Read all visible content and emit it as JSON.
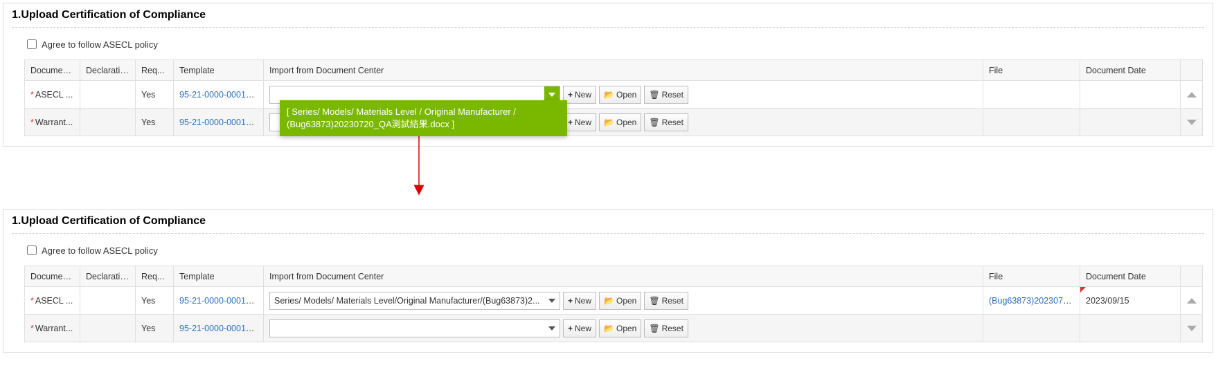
{
  "section_title": "1.Upload Certification of Compliance",
  "agree_label": "Agree to follow ASECL policy",
  "columns": {
    "doc": "Document...",
    "decl": "Declaratio...",
    "req": "Req...",
    "template": "Template",
    "import": "Import from Document Center",
    "file": "File",
    "date": "Document Date"
  },
  "btns": {
    "new": "New",
    "open": "Open",
    "reset": "Reset"
  },
  "dropdown_option": "[ Series/ Models/ Materials Level / Original Manufacturer / (Bug63873)20230720_QA測試結果.docx ]",
  "top": {
    "rows": [
      {
        "doc": "ASECL ...",
        "decl": "",
        "req": "Yes",
        "template": "95-21-0000-0001_1...",
        "combo_value": "",
        "file": "",
        "date": "",
        "caret": "up"
      },
      {
        "doc": "Warrant...",
        "decl": "",
        "req": "Yes",
        "template": "95-21-0000-0001_1...",
        "combo_value": "",
        "file": "",
        "date": "",
        "caret": "down"
      }
    ]
  },
  "bottom": {
    "rows": [
      {
        "doc": "ASECL ...",
        "decl": "",
        "req": "Yes",
        "template": "95-21-0000-0001_1...",
        "combo_value": "Series/ Models/ Materials Level/Original Manufacturer/(Bug63873)2...",
        "file": "(Bug63873)2023072...",
        "date": "2023/09/15",
        "caret": "up"
      },
      {
        "doc": "Warrant...",
        "decl": "",
        "req": "Yes",
        "template": "95-21-0000-0001_1...",
        "combo_value": "",
        "file": "",
        "date": "",
        "caret": "down"
      }
    ]
  }
}
